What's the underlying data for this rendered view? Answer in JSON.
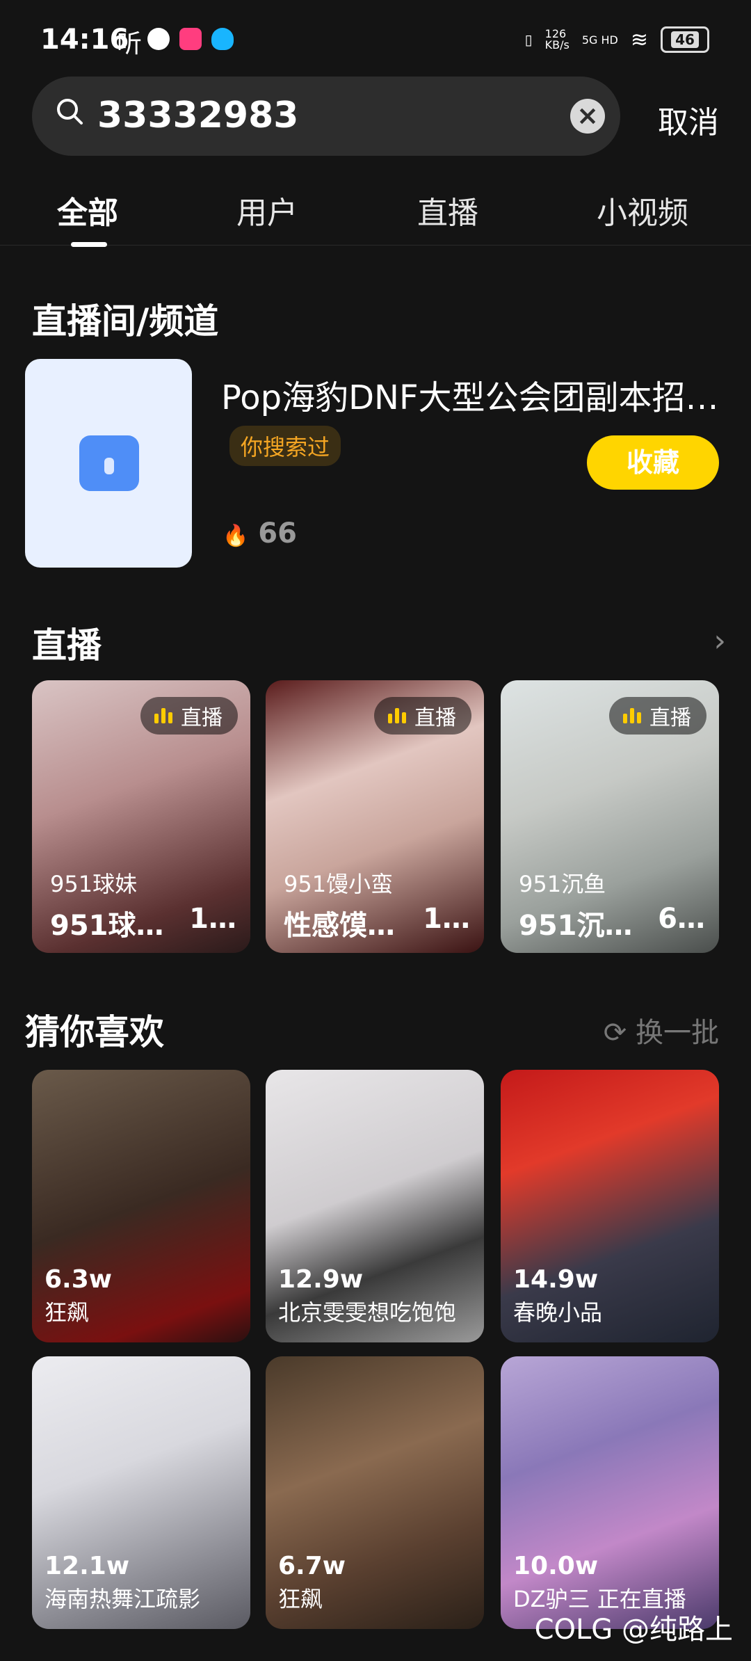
{
  "status": {
    "time": "14:16",
    "ting": "听",
    "net_speed": "126\nKB/s",
    "signal": "5G HD",
    "battery": "46"
  },
  "search": {
    "query": "33332983",
    "clear": "×",
    "cancel": "取消"
  },
  "tabs": [
    "全部",
    "用户",
    "直播",
    "小视频"
  ],
  "channel_section": {
    "title": "直播间/频道",
    "name": "Pop海豹DNF大型公会团副本招…",
    "tag": "你搜索过",
    "fav_button": "收藏",
    "heat": "66"
  },
  "live_section": {
    "title": "直播",
    "cards": [
      {
        "badge": "直播",
        "name": "951球妹",
        "subtitle": "951球…",
        "count": "1…"
      },
      {
        "badge": "直播",
        "name": "951馒小蛮",
        "subtitle": "性感馍…",
        "count": "1…"
      },
      {
        "badge": "直播",
        "name": "951沉鱼",
        "subtitle": "951沉…",
        "count": "6…"
      }
    ]
  },
  "rec_section": {
    "title": "猜你喜欢",
    "refresh": "换一批",
    "cards": [
      {
        "count": "6.3w",
        "label": "狂飙"
      },
      {
        "count": "12.9w",
        "label": "北京雯雯想吃饱饱"
      },
      {
        "count": "14.9w",
        "label": "春晚小品"
      },
      {
        "count": "12.1w",
        "label": "海南热舞江疏影"
      },
      {
        "count": "6.7w",
        "label": "狂飙"
      },
      {
        "count": "10.0w",
        "label": "DZ驴三 正在直播"
      }
    ]
  },
  "watermark": "COLG @纯路上"
}
